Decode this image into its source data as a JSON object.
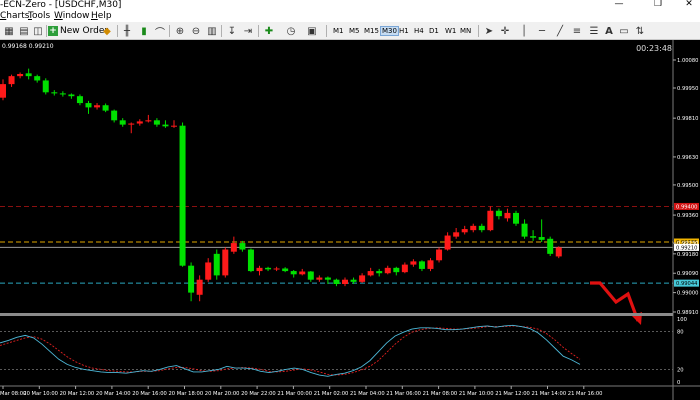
{
  "window": {
    "title": "-ECN-Zero - [USDCHF,M30]",
    "controls": [
      "—",
      "❐",
      "✕"
    ]
  },
  "menu": [
    {
      "label": "Charts",
      "underline": "C"
    },
    {
      "label": "Tools",
      "underline": "T"
    },
    {
      "label": "Window",
      "underline": "W"
    },
    {
      "label": "Help",
      "underline": "H"
    }
  ],
  "toolbar": {
    "new_order_label": "New Order",
    "timeframes": [
      "M1",
      "M5",
      "M15",
      "M30",
      "H1",
      "H4",
      "D1",
      "W1",
      "MN"
    ],
    "active_timeframe": "M30"
  },
  "chart": {
    "ohlc_readout": "0.99168 0.99210",
    "timer": "00:23:48",
    "price_axis": [
      "1.00080",
      "0.99950",
      "0.99810",
      "0.99630",
      "0.99500",
      "0.99360",
      "0.99230",
      "0.99180",
      "0.99090",
      "0.99000",
      "0.98910"
    ],
    "price_tags": [
      {
        "value": "0.99400",
        "color": "#d21414",
        "line": "#8a1010"
      },
      {
        "value": "0.99235",
        "color": "#f2b500",
        "line": "#e0a800"
      },
      {
        "value": "0.99210",
        "color": "#ffffff",
        "line": "#9a9a9a"
      },
      {
        "value": "0.99044",
        "color": "#46c8d8",
        "line": "#2aa8c0"
      }
    ],
    "osc_levels": [
      "100",
      "80",
      "20",
      "0"
    ],
    "time_axis": [
      "Mar 08:00",
      "20 Mar 10:00",
      "20 Mar 12:00",
      "20 Mar 14:00",
      "20 Mar 16:00",
      "20 Mar 18:00",
      "20 Mar 20:00",
      "20 Mar 22:00",
      "21 Mar 00:00",
      "21 Mar 02:00",
      "21 Mar 04:00",
      "21 Mar 06:00",
      "21 Mar 08:00",
      "21 Mar 10:00",
      "21 Mar 12:00",
      "21 Mar 14:00",
      "21 Mar 16:00"
    ],
    "colors": {
      "bull": "#00e000",
      "bear": "#ff1a1a",
      "grid": "#404040",
      "arrow": "#e01010",
      "k_line": "#4db8d8",
      "d_line": "#e02020"
    },
    "candles": [
      [
        0.99968,
        0.99905,
        0.9999,
        0.99893
      ],
      [
        1.00005,
        0.99968,
        1.00012,
        0.99955
      ],
      [
        1.00015,
        1.00005,
        1.00022,
        0.99995
      ],
      [
        1.00005,
        1.00018,
        1.0004,
        0.9999
      ],
      [
        0.99985,
        1.00005,
        1.00012,
        0.99975
      ],
      [
        0.9993,
        0.99985,
        0.99995,
        0.9992
      ],
      [
        0.99925,
        0.9993,
        0.9994,
        0.99915
      ],
      [
        0.9992,
        0.99925,
        0.99935,
        0.9991
      ],
      [
        0.99912,
        0.9992,
        0.99925,
        0.999
      ],
      [
        0.9988,
        0.99912,
        0.9992,
        0.9987
      ],
      [
        0.9986,
        0.9988,
        0.9989,
        0.9983
      ],
      [
        0.9987,
        0.9986,
        0.9988,
        0.9985
      ],
      [
        0.99845,
        0.9987,
        0.99878,
        0.99838
      ],
      [
        0.998,
        0.99845,
        0.9985,
        0.9979
      ],
      [
        0.9978,
        0.998,
        0.9981,
        0.9977
      ],
      [
        0.99785,
        0.9978,
        0.9979,
        0.9974
      ],
      [
        0.99795,
        0.99785,
        0.99805,
        0.99775
      ],
      [
        0.998,
        0.99795,
        0.99825,
        0.9979
      ],
      [
        0.9978,
        0.998,
        0.9981,
        0.9977
      ],
      [
        0.99772,
        0.9978,
        0.998,
        0.99765
      ],
      [
        0.99775,
        0.99772,
        0.998,
        0.99765
      ],
      [
        0.99125,
        0.99775,
        0.9979,
        0.9912
      ],
      [
        0.99,
        0.99125,
        0.9914,
        0.9896
      ],
      [
        0.9906,
        0.9899,
        0.9908,
        0.9896
      ],
      [
        0.9914,
        0.9906,
        0.9916,
        0.9905
      ],
      [
        0.9908,
        0.9918,
        0.992,
        0.9906
      ],
      [
        0.992,
        0.9908,
        0.9921,
        0.9907
      ],
      [
        0.9923,
        0.9919,
        0.9926,
        0.9918
      ],
      [
        0.992,
        0.9923,
        0.9924,
        0.9919
      ],
      [
        0.991,
        0.992,
        0.99205,
        0.99095
      ],
      [
        0.99115,
        0.991,
        0.99125,
        0.9908
      ],
      [
        0.99108,
        0.99115,
        0.9912,
        0.991
      ],
      [
        0.99112,
        0.99108,
        0.9912,
        0.991
      ],
      [
        0.991,
        0.99112,
        0.99118,
        0.99095
      ],
      [
        0.99085,
        0.991,
        0.99105,
        0.9907
      ],
      [
        0.99098,
        0.99085,
        0.9911,
        0.9908
      ],
      [
        0.9906,
        0.99098,
        0.991,
        0.9905
      ],
      [
        0.9907,
        0.9906,
        0.9908,
        0.9905
      ],
      [
        0.9906,
        0.9907,
        0.99075,
        0.9904
      ],
      [
        0.9904,
        0.9906,
        0.99065,
        0.9903
      ],
      [
        0.9906,
        0.9904,
        0.9907,
        0.9903
      ],
      [
        0.9905,
        0.9906,
        0.9907,
        0.9904
      ],
      [
        0.9908,
        0.9905,
        0.9909,
        0.99045
      ],
      [
        0.991,
        0.9908,
        0.99115,
        0.99075
      ],
      [
        0.9909,
        0.991,
        0.9911,
        0.99075
      ],
      [
        0.99115,
        0.9909,
        0.99125,
        0.99085
      ],
      [
        0.99095,
        0.99115,
        0.9912,
        0.9908
      ],
      [
        0.9913,
        0.99095,
        0.9914,
        0.9909
      ],
      [
        0.99145,
        0.9913,
        0.99155,
        0.9912
      ],
      [
        0.9911,
        0.99145,
        0.9915,
        0.991
      ],
      [
        0.9915,
        0.9911,
        0.9916,
        0.991
      ],
      [
        0.992,
        0.9915,
        0.9921,
        0.9914
      ],
      [
        0.99265,
        0.992,
        0.9928,
        0.99195
      ],
      [
        0.9928,
        0.9926,
        0.993,
        0.9925
      ],
      [
        0.99295,
        0.9928,
        0.9931,
        0.9927
      ],
      [
        0.9931,
        0.9929,
        0.9932,
        0.9928
      ],
      [
        0.9929,
        0.9931,
        0.9932,
        0.9928
      ],
      [
        0.9938,
        0.9929,
        0.994,
        0.99285
      ],
      [
        0.99355,
        0.9938,
        0.9939,
        0.9934
      ],
      [
        0.9937,
        0.99345,
        0.9939,
        0.9933
      ],
      [
        0.9932,
        0.9937,
        0.9938,
        0.9931
      ],
      [
        0.9926,
        0.9932,
        0.9934,
        0.9925
      ],
      [
        0.99255,
        0.99262,
        0.9929,
        0.9924
      ],
      [
        0.99245,
        0.99258,
        0.9934,
        0.99235
      ],
      [
        0.9918,
        0.9925,
        0.9926,
        0.9917
      ],
      [
        0.9921,
        0.99168,
        0.99215,
        0.9916
      ]
    ],
    "stoch_k": [
      62,
      66,
      71,
      74,
      70,
      60,
      48,
      36,
      28,
      23,
      20,
      18,
      16,
      15,
      15,
      14,
      16,
      18,
      17,
      20,
      24,
      26,
      21,
      16,
      16,
      18,
      20,
      25,
      22,
      22,
      21,
      17,
      15,
      17,
      20,
      22,
      20,
      15,
      11,
      9,
      12,
      14,
      18,
      24,
      34,
      48,
      62,
      73,
      79,
      84,
      86,
      86,
      85,
      83,
      83,
      84,
      86,
      88,
      89,
      87,
      89,
      90,
      88,
      85,
      78,
      67,
      54,
      41,
      35,
      28
    ],
    "stoch_d": [
      58,
      62,
      66,
      70,
      72,
      68,
      60,
      50,
      40,
      32,
      26,
      22,
      20,
      18,
      17,
      16,
      16,
      17,
      17,
      18,
      21,
      23,
      23,
      21,
      18,
      17,
      18,
      21,
      22,
      23,
      22,
      20,
      17,
      16,
      17,
      19,
      21,
      19,
      16,
      12,
      11,
      12,
      15,
      19,
      25,
      34,
      47,
      60,
      71,
      79,
      83,
      85,
      86,
      85,
      84,
      84,
      85,
      86,
      88,
      88,
      88,
      89,
      88,
      87,
      84,
      77,
      67,
      55,
      45,
      36
    ]
  }
}
